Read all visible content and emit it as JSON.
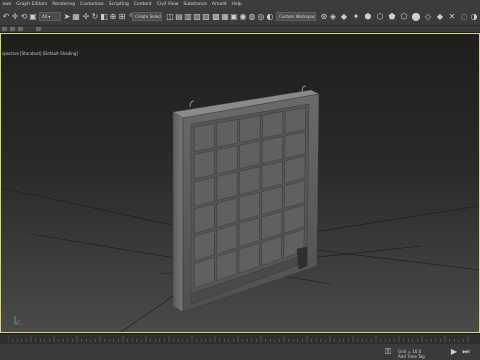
{
  "menu": {
    "items": [
      "ows",
      "Graph Editors",
      "Rendering",
      "Customize",
      "Scripting",
      "Content",
      "Civil View",
      "Substance",
      "Arnold",
      "Help"
    ]
  },
  "toolbar": {
    "selection_set_label": "Create Selection Se",
    "workspace_label": "Custom Workspace",
    "view_label": "View"
  },
  "viewport": {
    "label": "[Perspective] [Standard] [Default Shading]",
    "label_prefix": "spective",
    "background_top": "#1e1e1e",
    "background_bottom": "#4a4a4a",
    "border_color": "#d8d86a"
  },
  "status": {
    "grid_label": "Grid = 10.0",
    "add_time_tag_label": "Add Time Tag"
  },
  "colors": {
    "accent": "#5a8fd6",
    "panel": "#3b3b3b",
    "viewport_border": "#d8d86a"
  },
  "icons": [
    "undo-icon",
    "redo-icon",
    "link-icon",
    "unlink-icon",
    "select-icon",
    "move-icon",
    "rotate-icon",
    "scale-icon",
    "snap-icon",
    "angle-snap-icon",
    "percent-snap-icon",
    "mirror-icon",
    "align-icon",
    "render-icon",
    "teapot-icon",
    "key-icon",
    "play-icon"
  ]
}
